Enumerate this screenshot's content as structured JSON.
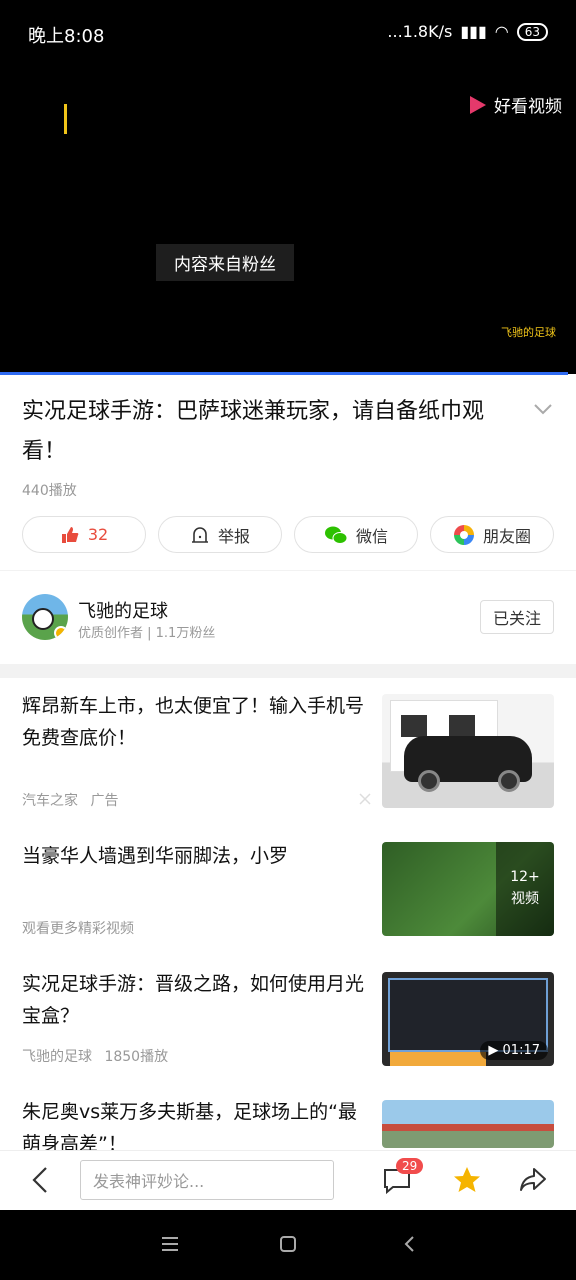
{
  "status_bar": {
    "time": "晚上8:08",
    "network": "...1.8K/s",
    "battery": "63"
  },
  "video": {
    "brand": "好看视频",
    "caption": "内容来自粉丝",
    "watermark": "飞驰的足球",
    "progress_fraction": 0.99
  },
  "article": {
    "title": "实况足球手游：巴萨球迷兼玩家，请自备纸巾观看！",
    "plays": "440播放",
    "actions": {
      "like_count": "32",
      "report": "举报",
      "wechat": "微信",
      "moments": "朋友圈"
    }
  },
  "author": {
    "name": "飞驰的足球",
    "meta": "优质创作者 | 1.1万粉丝",
    "follow_label": "已关注"
  },
  "feed": [
    {
      "title": "辉昂新车上市，也太便宜了！输入手机号免费查底价！",
      "source": "汽车之家",
      "tag": "广告"
    },
    {
      "title": "当豪华人墙遇到华丽脚法，小罗",
      "source": "观看更多精彩视频",
      "overlay": "12+\n视频"
    },
    {
      "title": "实况足球手游：晋级之路，如何使用月光宝盒？",
      "source": "飞驰的足球",
      "plays": "1850播放",
      "duration": "01:17"
    },
    {
      "title": "朱尼奥vs莱万多夫斯基，足球场上的“最萌身高差”！"
    }
  ],
  "bottom": {
    "comment_placeholder": "发表神评妙论...",
    "comment_count": "29"
  },
  "colors": {
    "like": "#e84c3d",
    "star": "#f5b400",
    "badge": "#f14c4c",
    "progress": "#2f6bf2"
  }
}
